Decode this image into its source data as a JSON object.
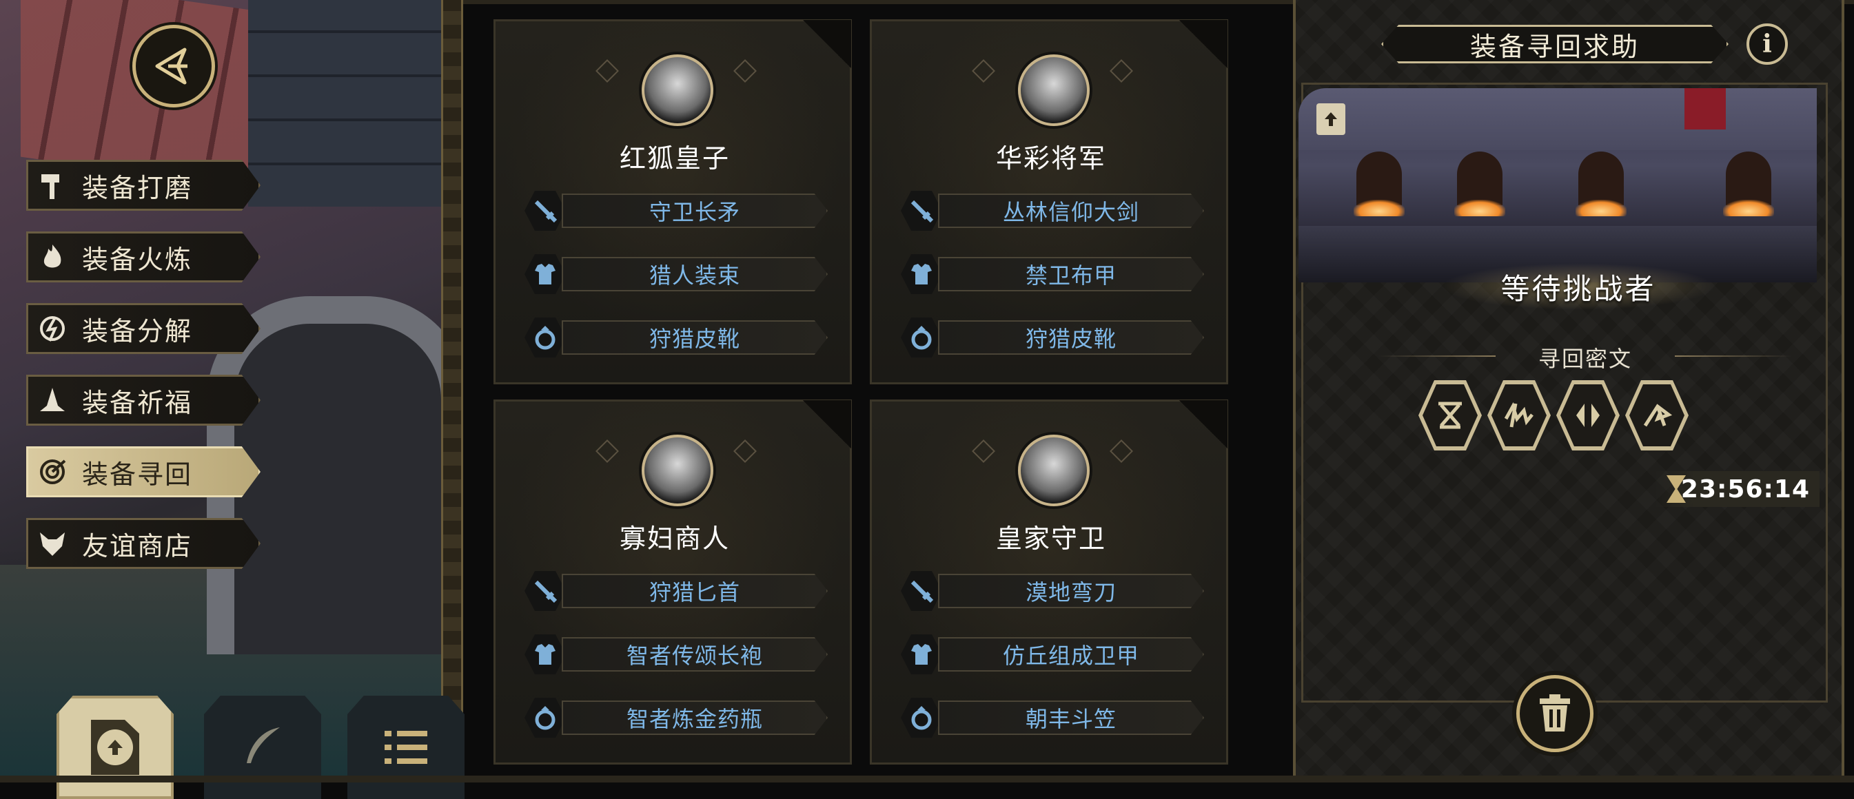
{
  "side_menu": {
    "items": [
      {
        "label": "装备打磨",
        "icon": "hammer-icon"
      },
      {
        "label": "装备火炼",
        "icon": "flame-icon"
      },
      {
        "label": "装备分解",
        "icon": "split-icon"
      },
      {
        "label": "装备祈福",
        "icon": "praying-hands-icon"
      },
      {
        "label": "装备寻回",
        "icon": "retrieve-spiral-icon",
        "selected": true
      },
      {
        "label": "友谊商店",
        "icon": "fox-head-icon"
      }
    ]
  },
  "bottom_buttons": [
    {
      "name": "upload-button",
      "icon": "upload-icon"
    },
    {
      "name": "feather-button",
      "icon": "feather-icon"
    },
    {
      "name": "list-button",
      "icon": "list-icon"
    }
  ],
  "cards": [
    {
      "name": "红狐皇子",
      "equipment": [
        {
          "slot": "weapon",
          "icon": "sword-icon",
          "label": "守卫长矛"
        },
        {
          "slot": "armor",
          "icon": "armor-icon",
          "label": "猎人装束"
        },
        {
          "slot": "accessory",
          "icon": "ring-icon",
          "label": "狩猎皮靴"
        }
      ]
    },
    {
      "name": "华彩将军",
      "equipment": [
        {
          "slot": "weapon",
          "icon": "sword-icon",
          "label": "丛林信仰大剑"
        },
        {
          "slot": "armor",
          "icon": "armor-icon",
          "label": "禁卫布甲"
        },
        {
          "slot": "accessory",
          "icon": "ring-icon",
          "label": "狩猎皮靴"
        }
      ]
    },
    {
      "name": "寡妇商人",
      "equipment": [
        {
          "slot": "weapon",
          "icon": "sword-icon",
          "label": "狩猎匕首"
        },
        {
          "slot": "armor",
          "icon": "armor-icon",
          "label": "智者传颂长袍"
        },
        {
          "slot": "accessory",
          "icon": "ring-icon",
          "label": "智者炼金药瓶"
        }
      ]
    },
    {
      "name": "皇家守卫",
      "equipment": [
        {
          "slot": "weapon",
          "icon": "sword-icon",
          "label": "漠地弯刀"
        },
        {
          "slot": "armor",
          "icon": "armor-icon",
          "label": "仿丘组成卫甲"
        },
        {
          "slot": "accessory",
          "icon": "ring-icon",
          "label": "朝丰斗笠"
        }
      ]
    }
  ],
  "right_panel": {
    "title": "装备寻回求助",
    "info_icon": "info-icon",
    "status": "等待挑战者",
    "section_title": "寻回密文",
    "runes": [
      "rune-1-icon",
      "rune-2-icon",
      "rune-3-icon",
      "rune-4-icon"
    ],
    "timer": "23:56:14",
    "delete_icon": "trash-icon"
  },
  "colors": {
    "gold": "#c9b27a",
    "equipment_text": "#7fb8e8",
    "equipment_icon": "#7fb0d8"
  }
}
